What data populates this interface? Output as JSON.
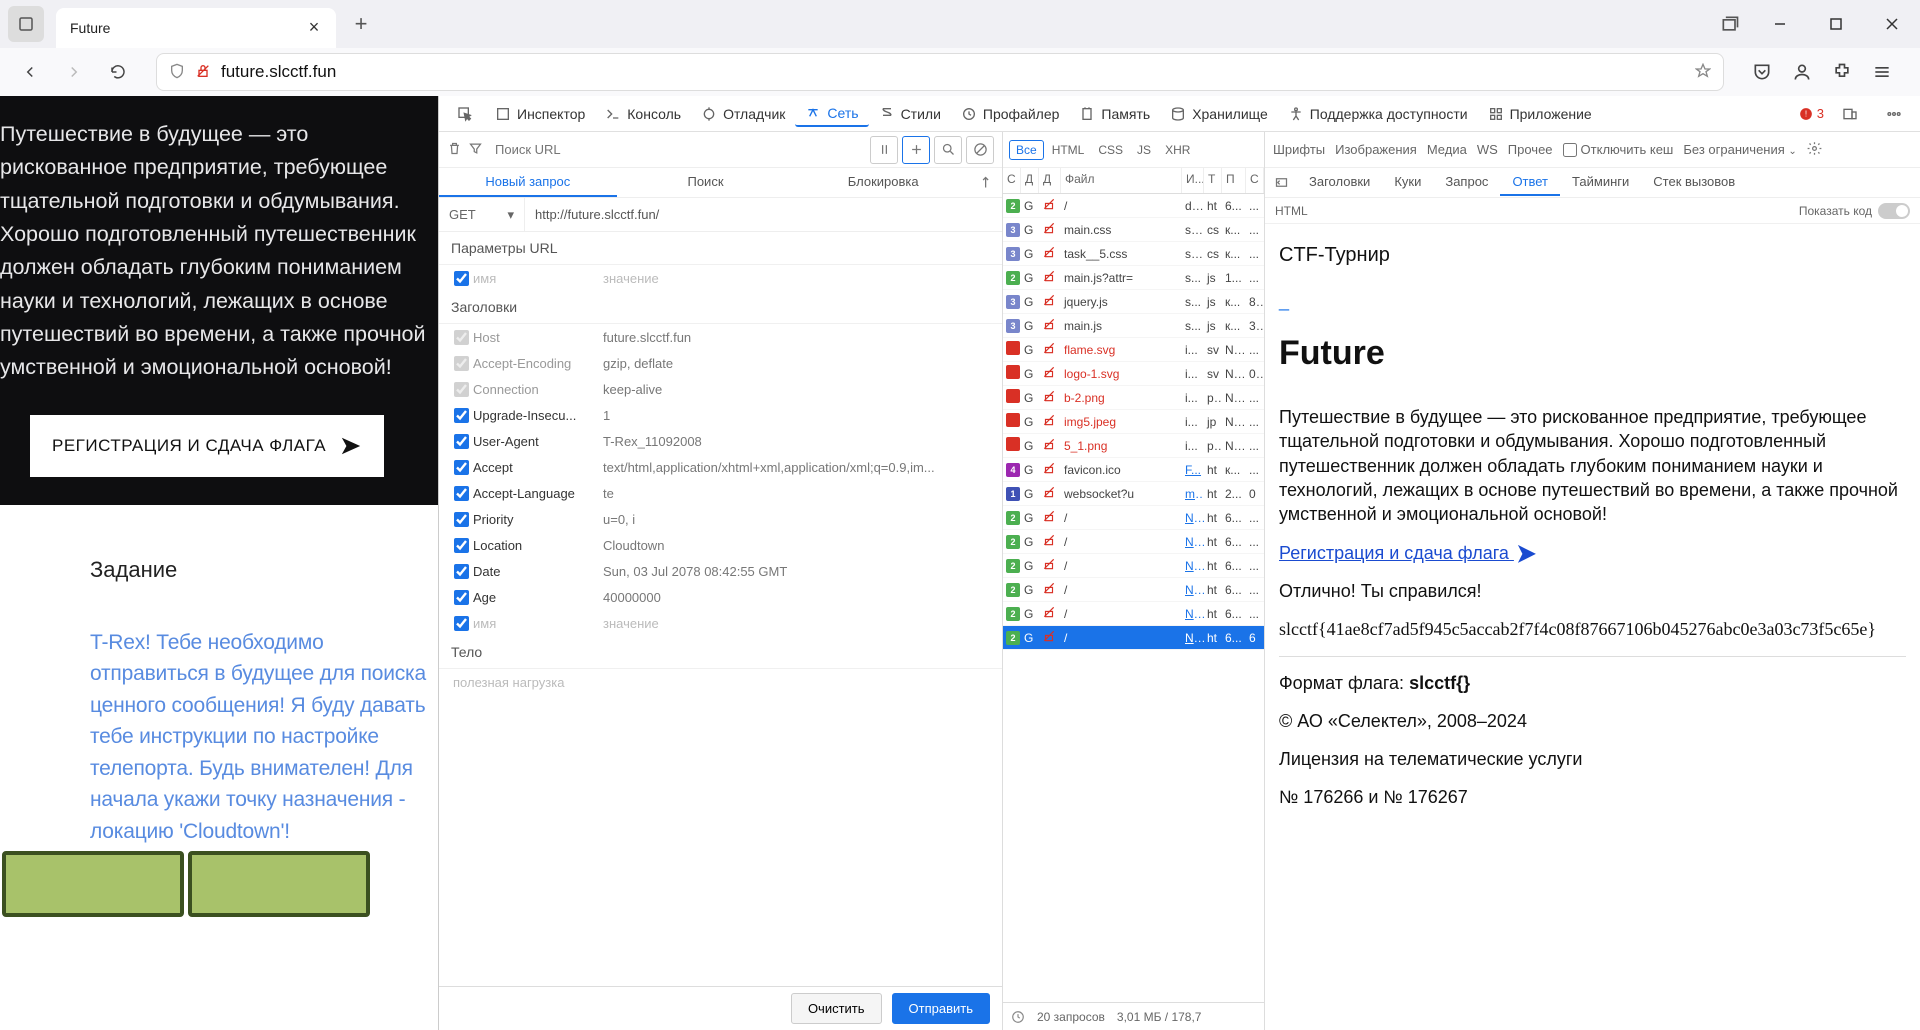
{
  "tab": {
    "title": "Future"
  },
  "url": {
    "domain": "future.slcctf.fun",
    "full": "future.slcctf.fun"
  },
  "page": {
    "intro": "Путешествие в будущее — это рискованное предприятие, требующее тщательной подготовки и обдумывания. Хорошо подготовленный путешественник должен обладать глубоким пониманием науки и технологий, лежащих в основе путешествий во времени, а также прочной умственной и эмоциональной основой!",
    "cta": "РЕГИСТРАЦИЯ И СДАЧА ФЛАГА",
    "task_head": "Задание",
    "task_body": "T-Rex! Тебе необходимо отправиться в будущее для поиска ценного сообщения! Я буду давать тебе инструкции по настройке телепорта. Будь внимателен! Для начала укажи точку назначения - локацию 'Cloudtown'!"
  },
  "devtools": {
    "tools": [
      "Инспектор",
      "Консоль",
      "Отладчик",
      "Сеть",
      "Стили",
      "Профайлер",
      "Память",
      "Хранилище",
      "Поддержка доступности",
      "Приложение"
    ],
    "active_tool": "Сеть",
    "errors": "3",
    "filter_placeholder": "Поиск URL",
    "net_filters": [
      "Все",
      "HTML",
      "CSS",
      "JS",
      "XHR",
      "Шрифты",
      "Изображения",
      "Медиа",
      "WS",
      "Прочее"
    ],
    "disable_cache": "Отключить кеш",
    "no_throttle": "Без ограничения",
    "req_tabs": {
      "new": "Новый запрос",
      "search": "Поиск",
      "block": "Блокировка"
    },
    "method": "GET",
    "req_url": "http://future.slcctf.fun/",
    "sec_params": "Параметры URL",
    "sec_headers": "Заголовки",
    "sec_body": "Тело",
    "ph_name": "имя",
    "ph_value": "значение",
    "payload_ph": "полезная нагрузка",
    "headers": [
      {
        "on": false,
        "name": "Host",
        "value": "future.slcctf.fun"
      },
      {
        "on": false,
        "name": "Accept-Encoding",
        "value": "gzip, deflate"
      },
      {
        "on": false,
        "name": "Connection",
        "value": "keep-alive"
      },
      {
        "on": true,
        "name": "Upgrade-Insecu...",
        "value": "1"
      },
      {
        "on": true,
        "name": "User-Agent",
        "value": "T-Rex_11092008"
      },
      {
        "on": true,
        "name": "Accept",
        "value": "text/html,application/xhtml+xml,application/xml;q=0.9,im..."
      },
      {
        "on": true,
        "name": "Accept-Language",
        "value": "te"
      },
      {
        "on": true,
        "name": "Priority",
        "value": "u=0, i"
      },
      {
        "on": true,
        "name": "Location",
        "value": "Cloudtown"
      },
      {
        "on": true,
        "name": "Date",
        "value": "Sun, 03 Jul 2078 08:42:55 GMT"
      },
      {
        "on": true,
        "name": "Age",
        "value": "40000000"
      }
    ],
    "btn_clear": "Очистить",
    "btn_send": "Отправить",
    "net_head": {
      "status": "С",
      "method": "Д",
      "domain": "Д",
      "file": "Файл",
      "init": "И...",
      "type": "Т",
      "trans": "П",
      "size": "С"
    },
    "rows": [
      {
        "st": "2",
        "stc": "st-2",
        "m": "G",
        "file": "/",
        "i": "d...",
        "t": "ht",
        "p": "6...",
        "s": "..."
      },
      {
        "st": "3",
        "stc": "st-3",
        "m": "G",
        "file": "main.css",
        "i": "st...",
        "t": "cs",
        "p": "к...",
        "s": "..."
      },
      {
        "st": "3",
        "stc": "st-3",
        "m": "G",
        "file": "task__5.css",
        "i": "st...",
        "t": "cs",
        "p": "к...",
        "s": "..."
      },
      {
        "st": "2",
        "stc": "st-2",
        "m": "G",
        "file": "main.js?attr=",
        "i": "s...",
        "t": "js",
        "p": "1...",
        "s": "..."
      },
      {
        "st": "3",
        "stc": "st-3",
        "m": "G",
        "file": "jquery.js",
        "i": "s...",
        "t": "js",
        "p": "к...",
        "s": "8..."
      },
      {
        "st": "3",
        "stc": "st-3",
        "m": "G",
        "file": "main.js",
        "i": "s...",
        "t": "js",
        "p": "к...",
        "s": "3..."
      },
      {
        "st": "",
        "stc": "st-e",
        "m": "G",
        "file": "flame.svg",
        "red": true,
        "i": "i...",
        "t": "sv",
        "p": "N...",
        "s": "..."
      },
      {
        "st": "",
        "stc": "st-e",
        "m": "G",
        "file": "logo-1.svg",
        "red": true,
        "i": "i...",
        "t": "sv",
        "p": "N...",
        "s": "0..."
      },
      {
        "st": "",
        "stc": "st-e",
        "m": "G",
        "file": "b-2.png",
        "red": true,
        "i": "i...",
        "t": "p...",
        "p": "N...",
        "s": "..."
      },
      {
        "st": "",
        "stc": "st-e",
        "m": "G",
        "file": "img5.jpeg",
        "red": true,
        "i": "i...",
        "t": "jp",
        "p": "N...",
        "s": "..."
      },
      {
        "st": "",
        "stc": "st-e",
        "m": "G",
        "file": "5_1.png",
        "red": true,
        "i": "i...",
        "t": "p...",
        "p": "N...",
        "s": "..."
      },
      {
        "st": "4",
        "stc": "st-4",
        "m": "G",
        "file": "favicon.ico",
        "i": "F...",
        "link": true,
        "t": "ht",
        "p": "к...",
        "s": "..."
      },
      {
        "st": "1",
        "stc": "st-1",
        "m": "G",
        "file": "websocket?u",
        "i": "mair",
        "link": true,
        "t": "ht",
        "p": "2...",
        "s": "0"
      },
      {
        "st": "2",
        "stc": "st-2",
        "m": "G",
        "file": "/",
        "i": "N...",
        "link": true,
        "t": "ht",
        "p": "6...",
        "s": "..."
      },
      {
        "st": "2",
        "stc": "st-2",
        "m": "G",
        "file": "/",
        "i": "N...",
        "link": true,
        "t": "ht",
        "p": "6...",
        "s": "..."
      },
      {
        "st": "2",
        "stc": "st-2",
        "m": "G",
        "file": "/",
        "i": "N...",
        "link": true,
        "t": "ht",
        "p": "6...",
        "s": "..."
      },
      {
        "st": "2",
        "stc": "st-2",
        "m": "G",
        "file": "/",
        "i": "N...",
        "link": true,
        "t": "ht",
        "p": "6...",
        "s": "..."
      },
      {
        "st": "2",
        "stc": "st-2",
        "m": "G",
        "file": "/",
        "i": "N...",
        "link": true,
        "t": "ht",
        "p": "6...",
        "s": "..."
      },
      {
        "st": "2",
        "stc": "st-2",
        "m": "G",
        "file": "/",
        "i": "N...",
        "link": true,
        "t": "ht",
        "p": "6...",
        "s": "6",
        "sel": true
      }
    ],
    "status_reqs": "20 запросов",
    "status_size": "3,01 МБ / 178,7",
    "resp_tabs": [
      "Заголовки",
      "Куки",
      "Запрос",
      "Ответ",
      "Тайминги",
      "Стек вызовов"
    ],
    "resp_active": "Ответ",
    "resp_type": "HTML",
    "resp_raw": "Показать код"
  },
  "response": {
    "h3": "CTF-Турнир",
    "h1": "Future",
    "p1": "Путешествие в будущее — это рискованное предприятие, требующее тщательной подготовки и обдумывания. Хорошо подготовленный путешественник должен обладать глубоким пониманием науки и технологий, лежащих в основе путешествий во времени, а также прочной умственной и эмоциональной основой!",
    "reg": "Регистрация и сдача флага ",
    "success": "Отлично! Ты справился!",
    "flag": "slcctf{41ae8cf7ad5f945c5accab2f7f4c08f87667106b045276abc0e3a03c73f5c65e}",
    "fmt_label": "Формат флага: ",
    "fmt_val": "slcctf{}",
    "foot1": "© АО «Селектел», 2008–2024",
    "foot2": "Лицензия на телематические услуги",
    "foot3": "№ 176266 и № 176267"
  }
}
